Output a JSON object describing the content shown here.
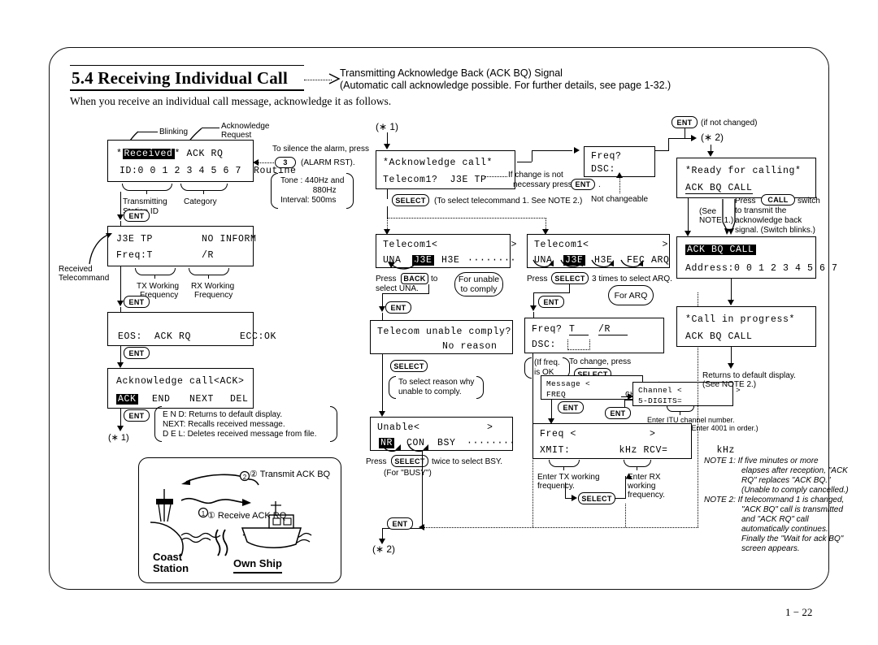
{
  "page": {
    "section_number": "5.4",
    "section_title": "5.4 Receiving Individual Call",
    "header_note_line1": "Transmitting Acknowledge Back (ACK BQ) Signal",
    "header_note_line2": "(Automatic call acknowledge possible. For further details, see page 1-32.)",
    "intro": "When you receive an individual call message, acknowledge it as follows.",
    "page_number": "1 − 22"
  },
  "left_column": {
    "callout_blinking": "Blinking",
    "callout_ack_request_l1": "Acknowledge",
    "callout_ack_request_l2": "Request",
    "screen1": {
      "line1_a": "*",
      "line1_inv": "Received",
      "line1_b": "* ACK RQ",
      "line2": "ID:0 0 1 2 3 4 5 6 7  Routine"
    },
    "brace_tx_id_l1": "Transmitting",
    "brace_tx_id_l2": "Station ID",
    "brace_category": "Category",
    "alarm_note_l1": "To silence the alarm, press",
    "alarm_key": "3",
    "alarm_note_l2": "(ALARM RST).",
    "tone_l1": "Tone  : 440Hz and",
    "tone_l2": "880Hz",
    "tone_l3": "Interval: 500ms",
    "key_ent": "ENT",
    "screen2": {
      "line1": "J3E TP        NO INFORM",
      "line2": "Freq:T        /R"
    },
    "received_telecommand_l1": "Received",
    "received_telecommand_l2": "Telecommand",
    "tx_working_l1": "TX Working",
    "tx_working_l2": "Frequency",
    "rx_working_l1": "RX Working",
    "rx_working_l2": "Frequency",
    "screen3": {
      "line1": "EOS:  ACK RQ        ECC:OK"
    },
    "screen4": {
      "line1": "Acknowledge call<ACK>",
      "opt_inv": "ACK",
      "opt2": "END",
      "opt3": "NEXT",
      "opt4": "DEL"
    },
    "star1": "(∗ 1)",
    "legend_end": "E N D: Returns to default display.",
    "legend_next": "NEXT: Recalls received message.",
    "legend_del": "D E L: Deletes received message from file."
  },
  "illustration": {
    "arrow_transmit": "② Transmit ACK BQ",
    "arrow_receive": "① Receive ACK RQ",
    "coast_station_l1": "Coast",
    "coast_station_l2": "Station",
    "own_ship": "Own Ship"
  },
  "middle_column": {
    "star1": "(∗ 1)",
    "screen_ack": {
      "line1": "*Acknowledge call*",
      "line2": "Telecom1?  J3E TP"
    },
    "note_if_change_l1": "If change is not",
    "note_if_change_l2": "necessary press",
    "key_ent": "ENT",
    "note_if_change_end": ".",
    "key_select": "SELECT",
    "note_select_telecom": "(To select telecommand 1. See NOTE 2.)",
    "screen_telecom_left": {
      "line1": "Telecom1<            >",
      "o1": "UNA",
      "o2_inv": "J3E",
      "o3": "H3E",
      "dots": "········"
    },
    "press_back_l1": "Press",
    "key_back": "BACK",
    "press_back_l1b": "to",
    "press_back_l2": "select UNA.",
    "bubble_unable_l1": "For unable",
    "bubble_unable_l2": "to comply",
    "screen_unable_comply": {
      "line1": "Telecom unable comply?",
      "line2": "No reason"
    },
    "paren_reason_l1": "To select reason why",
    "paren_reason_l2": "unable to comply.",
    "screen_unable": {
      "line1": "Unable<           >",
      "o1_inv": "NR",
      "o2": "CON",
      "o3": "BSY",
      "dots": "········"
    },
    "press_select_twice_a": "Press",
    "press_select_twice_b": "twice to select BSY.",
    "for_busy": "(For \"BUSY\")",
    "star2_bottom": "(∗ 2)",
    "screen_telecom_right": {
      "line1": "Telecom1<            >",
      "o1": "UNA",
      "o2_inv": "J3E",
      "o3": "H3E",
      "o4": "FEC",
      "o5": "ARQ"
    },
    "press_select_3times_a": "Press",
    "press_select_3times_b": "3 times to select ARQ.",
    "bubble_arq": "For ARQ",
    "screen_freq_dsc": {
      "line1_a": "Freq?",
      "line1_t": "T",
      "line1_r": "/R",
      "line2": "DSC:"
    },
    "paren_freq_ok_l1": "(If freq.",
    "paren_freq_ok_l2": "is OK",
    "to_change_press": "To change, press",
    "screen_message": {
      "line1": "Message <              >",
      "opt_freq": "FREQ",
      "opt_ch": "CH"
    },
    "screen_channel": {
      "line1": "Channel <           >",
      "line2": "5-DIGITS="
    },
    "itu_note_l1": "Enter ITU channel number.",
    "itu_note_l2": "(ex. CH4001→Enter 4001 in order.)",
    "screen_freq": {
      "line1": "Freq <            >",
      "line2": "XMIT:        kHz RCV=        kHz"
    },
    "enter_tx_l1": "Enter TX working",
    "enter_tx_l2": "frequency.",
    "enter_rx_l1": "Enter RX",
    "enter_rx_l2": "working",
    "enter_rx_l3": "frequency.",
    "freq_box_top": {
      "line1": "Freq?",
      "line2": "DSC:"
    },
    "not_changeable": "Not changeable"
  },
  "right_column": {
    "key_ent": "ENT",
    "if_not_changed": "(if not changed)",
    "star2": "(∗ 2)",
    "screen_ready": {
      "line1": "*Ready for calling*",
      "line2": "ACK BQ CALL"
    },
    "see_note1_l1": "(See",
    "see_note1_l2": "NOTE 1.)",
    "press_call_l1": "Press",
    "key_call": "CALL",
    "press_call_l1b": "switch",
    "press_call_l2": "to transmit the",
    "press_call_l3": "acknowledge back",
    "press_call_l4": "signal. (Switch blinks.)",
    "screen_ackbq": {
      "line1_inv": "ACK BQ CALL",
      "line2": "Address:0 0 1 2 3 4 5 6 7"
    },
    "screen_progress": {
      "line1": "*Call in progress*",
      "line2": "ACK BQ CALL"
    },
    "returns_l1": "Returns to default display.",
    "returns_l2": "(See NOTE 2.)",
    "notes": [
      "NOTE 1: If five minutes or more",
      "elapses after reception, \"ACK",
      "RQ\" replaces \"ACK BQ.\"",
      "(Unable to comply cancelled.)",
      "NOTE 2: If telecommand 1 is changed,",
      "\"ACK BQ\" call is transmitted",
      "and \"ACK RQ\" call",
      "automatically continues.",
      "Finally the \"Wait for ack BQ\"",
      "screen appears."
    ]
  }
}
